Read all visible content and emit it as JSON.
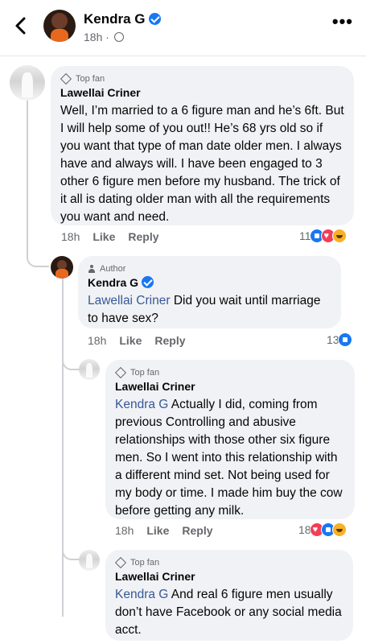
{
  "header": {
    "name": "Kendra G",
    "time": "18h",
    "back_icon": "chevron-left-icon",
    "more_icon": "more-dots-icon",
    "more_label": "•••"
  },
  "comments": [
    {
      "badge": "Top fan",
      "author": "Lawellai Criner",
      "text": "Well, I’m married to a 6 figure man and he’s 6ft. But I will help some of you out!! He’s 68 yrs old so if you want that type of man date older men. I always have and always will. I have been engaged to 3 other 6 figure men before my husband. The trick of it all is dating older man with all the requirements you want and need.",
      "time": "18h",
      "like": "Like",
      "reply": "Reply",
      "reaction_count": "11"
    },
    {
      "badge": "Author",
      "author": "Kendra G",
      "mention": "Lawellai Criner",
      "text": " Did you wait until marriage to have sex?",
      "time": "18h",
      "like": "Like",
      "reply": "Reply",
      "reaction_count": "13"
    },
    {
      "badge": "Top fan",
      "author": "Lawellai Criner",
      "mention": "Kendra G",
      "text": " Actually I did, coming from previous Controlling and abusive relationships with those other six figure men. So I went into this relationship with a different mind set. Not being used for my body or time. I made him buy the cow before getting any milk.",
      "time": "18h",
      "like": "Like",
      "reply": "Reply",
      "reaction_count": "18"
    },
    {
      "badge": "Top fan",
      "author": "Lawellai Criner",
      "mention": "Kendra G",
      "text": " And real 6 figure men usually don’t have Facebook or any social media acct."
    }
  ],
  "colors": {
    "accent": "#1877f2",
    "mention": "#385898",
    "bubble": "#f0f2f5",
    "muted": "#65676b"
  }
}
